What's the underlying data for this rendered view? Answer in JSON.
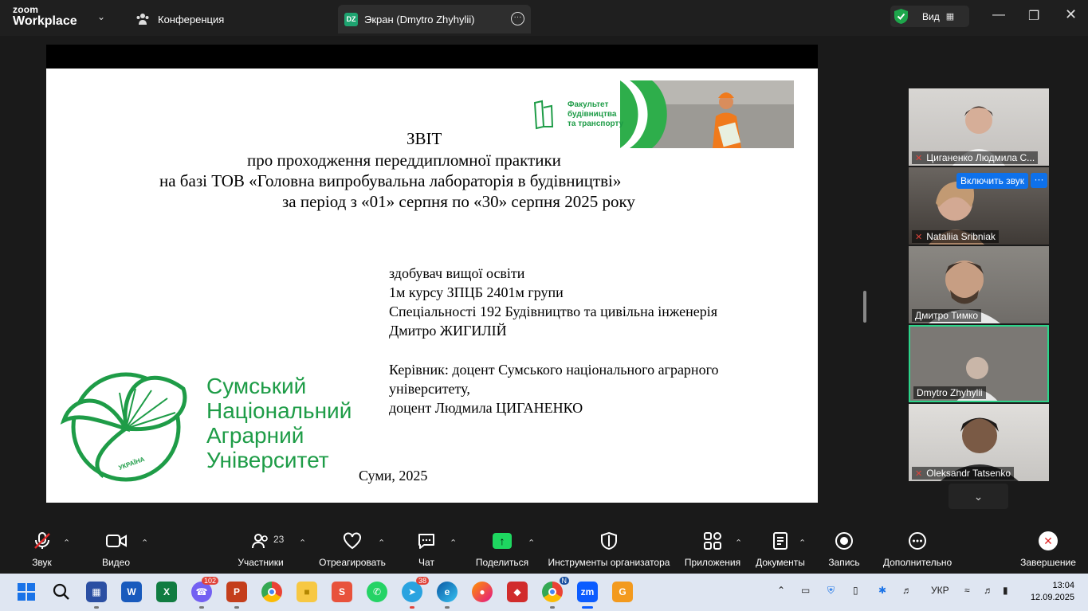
{
  "app": {
    "logo_top": "zoom",
    "logo_bottom": "Workplace"
  },
  "tabs": [
    {
      "label": "Конференция"
    },
    {
      "label": "Экран (Dmytro Zhyhylii)",
      "badge": "DZ"
    }
  ],
  "view_button": {
    "label": "Вид"
  },
  "slide": {
    "title": "ЗВІТ",
    "line1": "про проходження переддипломної практики",
    "line2": "на базі  ТОВ «Головна випробувальна лабораторія в будівництві»",
    "line3": "за період з «01» серпня по «30» серпня 2025 року",
    "student1": "здобувач вищої освіти",
    "student2": "1м курсу ЗПЦБ 2401м групи",
    "student3": "Спеціальності  192 Будівництво та цивільна інженерія",
    "student4": "Дмитро ЖИГИЛІЙ",
    "sup1": "Керівник: доцент Сумського національного аграрного",
    "sup2": "університету,",
    "sup3": "доцент Людмила ЦИГАНЕНКО",
    "city": "Суми, 2025",
    "banner_text": [
      "Факультет",
      "будівництва",
      "та транспорту"
    ],
    "uni_name": [
      "Сумський",
      "Національний",
      "Аграрний",
      "Університет"
    ],
    "emblem_text": "УКРАЇНА"
  },
  "participants": [
    {
      "name": "Циганенко Людмила С...",
      "muted": true
    },
    {
      "name": "Nataliia Sribniak",
      "muted": true,
      "unmute_label": "Включить звук"
    },
    {
      "name": "Дмитро Тимко",
      "muted": false
    },
    {
      "name": "Dmytro Zhyhylii",
      "muted": false,
      "active": true
    },
    {
      "name": "Oleksandr Tatsenko",
      "muted": true
    }
  ],
  "toolbar": {
    "audio": "Звук",
    "video": "Видео",
    "participants": "Участники",
    "participants_count": "23",
    "react": "Отреагировать",
    "chat": "Чат",
    "share": "Поделиться",
    "host_tools": "Инструменты организатора",
    "apps": "Приложения",
    "docs": "Документы",
    "record": "Запись",
    "more": "Дополнительно",
    "end": "Завершение"
  },
  "taskbar": {
    "viber_badge": "102",
    "telegram_badge": "38",
    "chrome_badge": "N",
    "zoom_label": "zm",
    "lang": "УКР",
    "time": "13:04",
    "date": "12.09.2025"
  },
  "colors": {
    "accent_green": "#1e9c47",
    "zoom_blue": "#0e71eb",
    "active_border": "#2cd48a"
  }
}
